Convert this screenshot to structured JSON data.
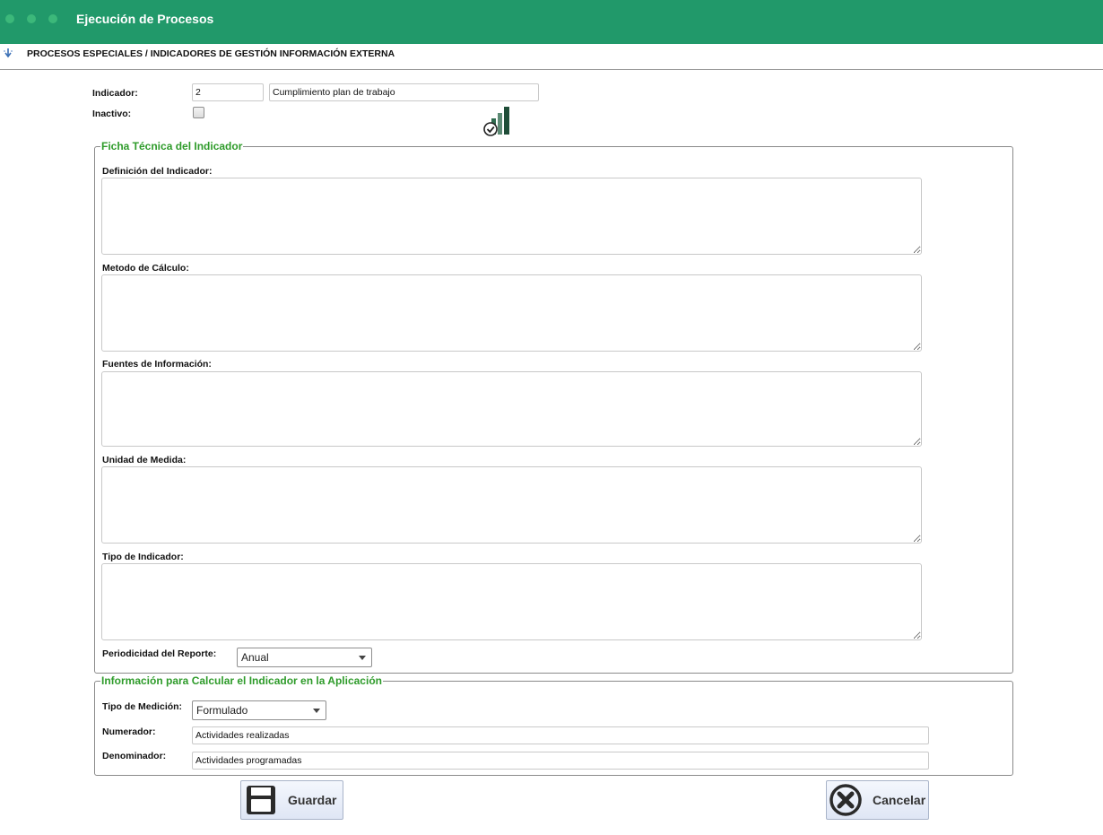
{
  "window": {
    "title": "Ejecución de Procesos"
  },
  "breadcrumb": {
    "text": "PROCESOS ESPECIALES / INDICADORES DE GESTIÓN INFORMACIÓN EXTERNA"
  },
  "indicator": {
    "label": "Indicador:",
    "code": "2",
    "name": "Cumplimiento plan de trabajo",
    "inactive_label": "Inactivo:",
    "inactive_checked": false
  },
  "ficha": {
    "legend": "Ficha Técnica del Indicador",
    "definicion_label": "Definición del Indicador:",
    "metodo_label": "Metodo de Cálculo:",
    "fuentes_label": "Fuentes de Información:",
    "unidad_label": "Unidad de Medida:",
    "tipo_label": "Tipo de Indicador:",
    "periodicidad_label": "Periodicidad del Reporte:",
    "periodicidad_value": "Anual"
  },
  "calculo": {
    "legend": "Información para Calcular el Indicador en la Aplicación",
    "tipo_medicion_label": "Tipo de Medición:",
    "tipo_medicion_value": "Formulado",
    "numerador_label": "Numerador:",
    "numerador_value": "Actividades realizadas",
    "denominador_label": "Denominador:",
    "denominador_value": "Actividades programadas"
  },
  "actions": {
    "save_label": "Guardar",
    "cancel_label": "Cancelar"
  },
  "icons": {
    "save": "floppy-disk-icon",
    "cancel": "circle-x-icon",
    "chart": "bar-chart-check-icon",
    "breadcrumb": "arrow-down-icon"
  },
  "colors": {
    "header": "#21996a",
    "legend": "#2e9b2a",
    "chart_green": "#2f6a4e"
  }
}
